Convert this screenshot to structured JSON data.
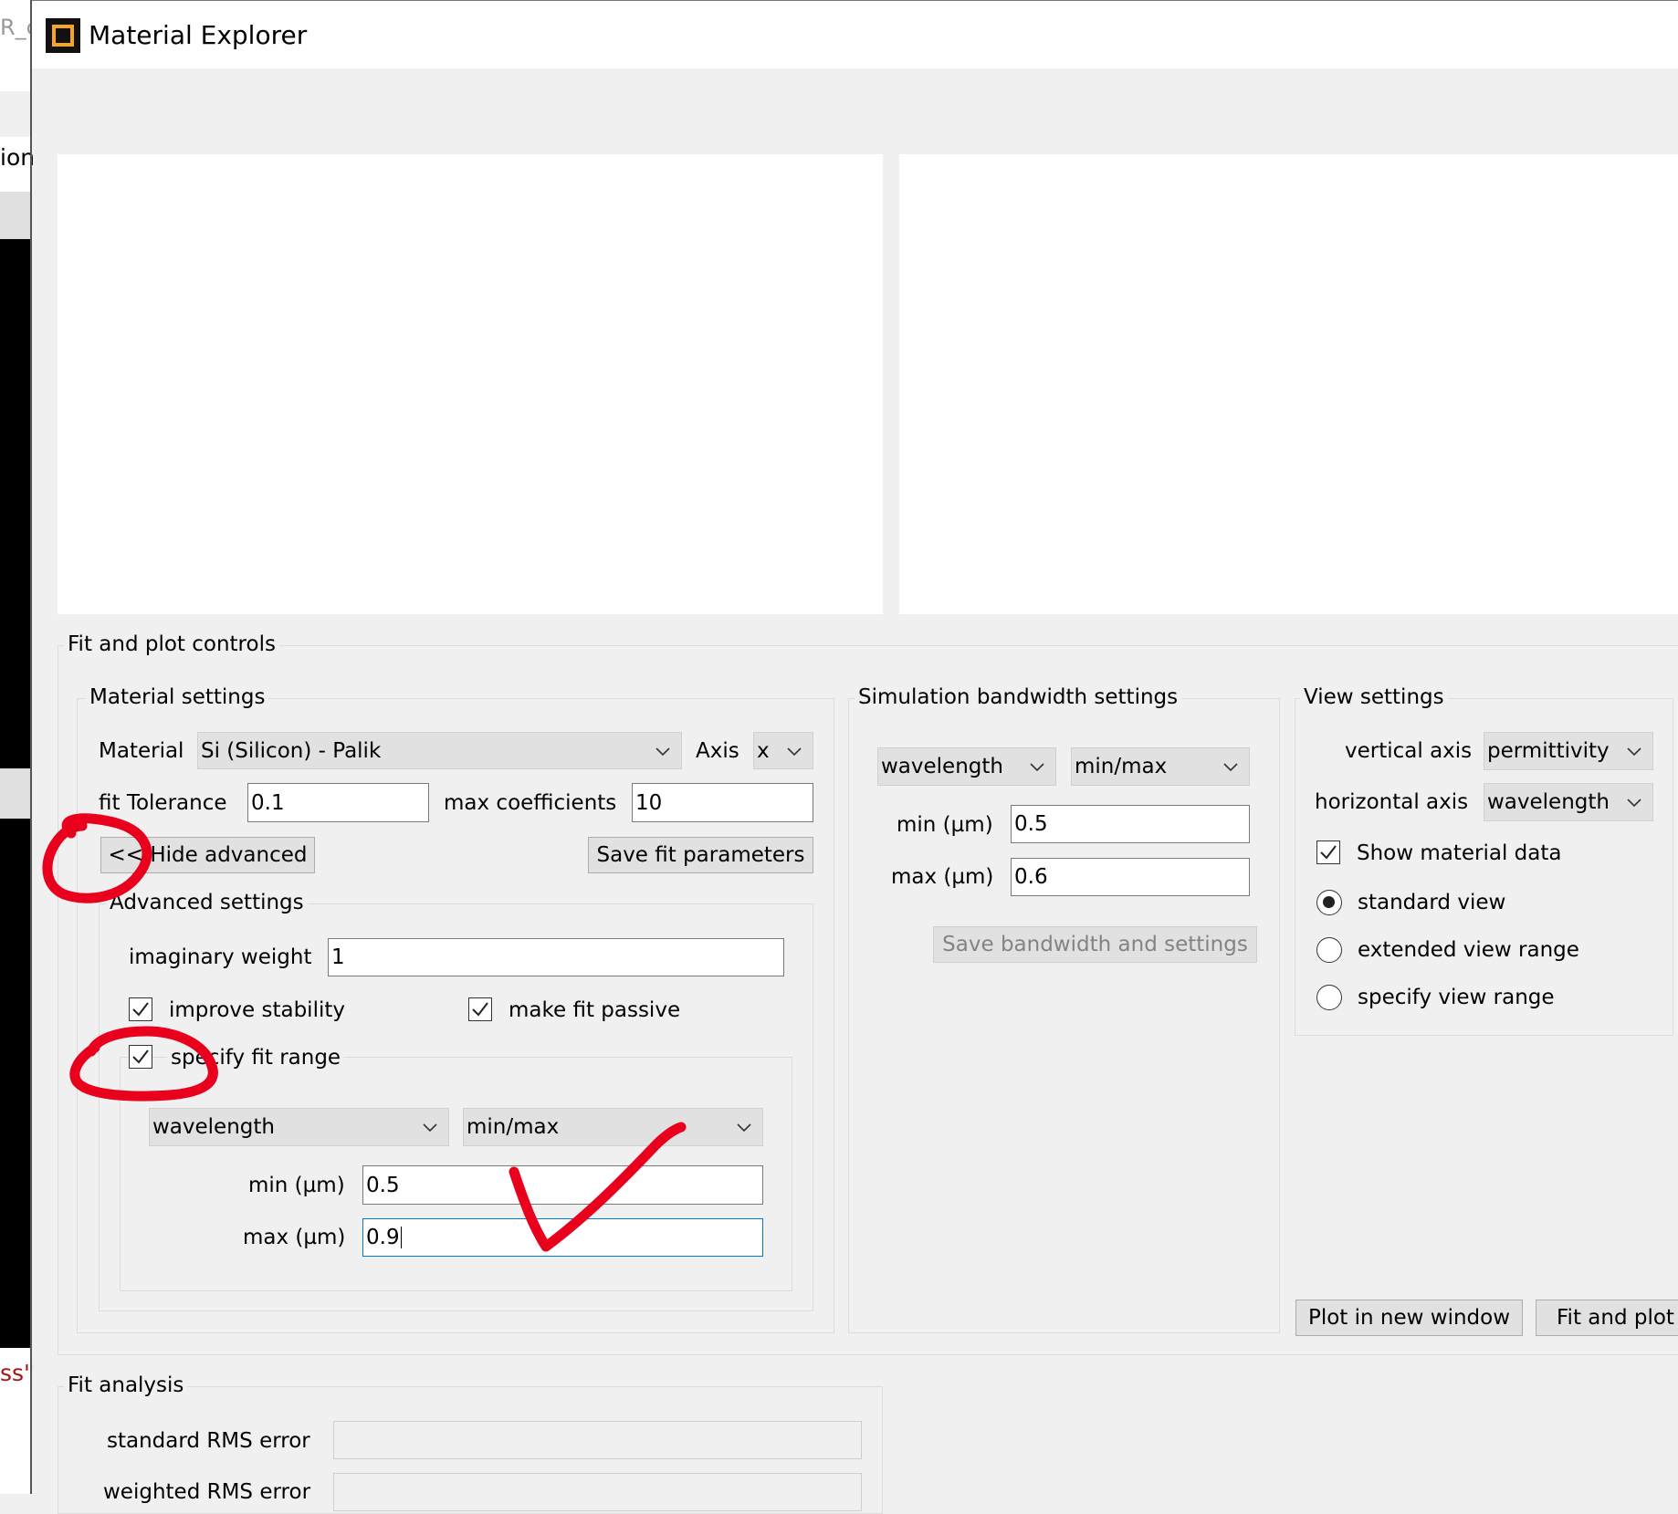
{
  "window": {
    "title": "Material Explorer"
  },
  "background_app": {
    "frag_top": "R_c",
    "frag_mid": "ion",
    "frag_bottom": "ss\""
  },
  "fit_plot": {
    "title": "Fit and plot controls",
    "material_settings": {
      "title": "Material settings",
      "material_label": "Material",
      "material_value": "Si (Silicon) - Palik",
      "axis_label": "Axis",
      "axis_value": "x",
      "fit_tolerance_label": "fit Tolerance",
      "fit_tolerance_value": "0.1",
      "max_coeff_label": "max coefficients",
      "max_coeff_value": "10",
      "hide_advanced": "<< Hide advanced",
      "save_fit": "Save fit parameters"
    },
    "advanced": {
      "title": "Advanced settings",
      "imag_weight_label": "imaginary weight",
      "imag_weight_value": "1",
      "improve_stability": "improve stability",
      "make_passive": "make fit passive",
      "specify_range": "specify fit range",
      "range_type": "wavelength",
      "range_mode": "min/max",
      "min_label": "min (µm)",
      "min_value": "0.5",
      "max_label": "max (µm)",
      "max_value": "0.9"
    },
    "simulation": {
      "title": "Simulation bandwidth settings",
      "type": "wavelength",
      "mode": "min/max",
      "min_label": "min (µm)",
      "min_value": "0.5",
      "max_label": "max (µm)",
      "max_value": "0.6",
      "save": "Save bandwidth and settings"
    },
    "view": {
      "title": "View settings",
      "vertical_label": "vertical axis",
      "vertical_value": "permittivity",
      "horizontal_label": "horizontal axis",
      "horizontal_value": "wavelength",
      "show_data": "Show material data",
      "standard": "standard view",
      "extended": "extended view range",
      "specify": "specify view range"
    },
    "plot_new_window": "Plot in new window",
    "fit_and_plot": "Fit and plot"
  },
  "fit_analysis": {
    "title": "Fit analysis",
    "standard_rms": "standard RMS error",
    "weighted_rms": "weighted RMS error"
  },
  "colors": {
    "annotation_red": "#e8001c",
    "logo_orange": "#f5a623",
    "focus_blue": "#0078d7"
  }
}
